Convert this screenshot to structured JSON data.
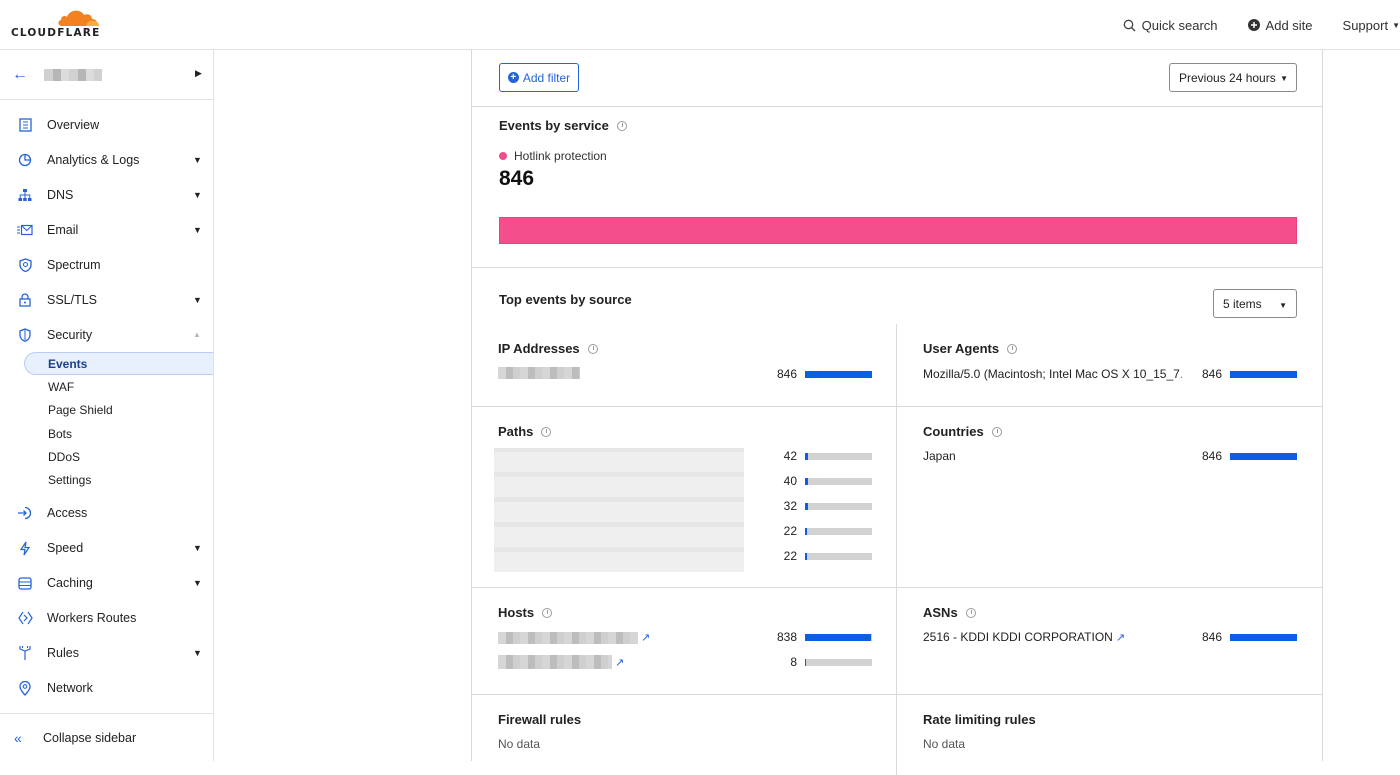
{
  "topbar": {
    "logo_text": "CLOUDFLARE",
    "quick_search": "Quick search",
    "add_site": "Add site",
    "support": "Support"
  },
  "sidebar": {
    "items": [
      {
        "label": "Overview",
        "icon": "document-icon",
        "caret": false
      },
      {
        "label": "Analytics & Logs",
        "icon": "chart-icon",
        "caret": true
      },
      {
        "label": "DNS",
        "icon": "network-tree-icon",
        "caret": true
      },
      {
        "label": "Email",
        "icon": "email-icon",
        "caret": true
      },
      {
        "label": "Spectrum",
        "icon": "shield-spectrum-icon",
        "caret": false
      },
      {
        "label": "SSL/TLS",
        "icon": "lock-icon",
        "caret": true
      },
      {
        "label": "Security",
        "icon": "shield-icon",
        "caret": "up"
      }
    ],
    "security_sub": [
      "Events",
      "WAF",
      "Page Shield",
      "Bots",
      "DDoS",
      "Settings"
    ],
    "items_after": [
      {
        "label": "Access",
        "icon": "access-icon",
        "caret": false
      },
      {
        "label": "Speed",
        "icon": "lightning-icon",
        "caret": true
      },
      {
        "label": "Caching",
        "icon": "caching-icon",
        "caret": true
      },
      {
        "label": "Workers Routes",
        "icon": "workers-icon",
        "caret": false
      },
      {
        "label": "Rules",
        "icon": "rules-icon",
        "caret": true
      },
      {
        "label": "Network",
        "icon": "location-pin-icon",
        "caret": false
      }
    ],
    "collapse_label": "Collapse sidebar"
  },
  "filters": {
    "add_filter": "Add filter",
    "time_range": "Previous 24 hours"
  },
  "events_by_service": {
    "title": "Events by service",
    "legend": "Hotlink protection",
    "total": "846",
    "color": "#f54e8c"
  },
  "top_events": {
    "title": "Top events by source",
    "items_select": "5 items",
    "ip_addresses": {
      "title": "IP Addresses",
      "rows": [
        {
          "value": 846,
          "max": 846
        }
      ]
    },
    "user_agents": {
      "title": "User Agents",
      "rows": [
        {
          "label": "Mozilla/5.0 (Macintosh; Intel Mac OS X 10_15_7…",
          "value": 846,
          "max": 846
        }
      ]
    },
    "paths": {
      "title": "Paths",
      "rows": [
        {
          "value": 42,
          "max": 846
        },
        {
          "value": 40,
          "max": 846
        },
        {
          "value": 32,
          "max": 846
        },
        {
          "value": 22,
          "max": 846
        },
        {
          "value": 22,
          "max": 846
        }
      ]
    },
    "countries": {
      "title": "Countries",
      "rows": [
        {
          "label": "Japan",
          "value": 846,
          "max": 846
        }
      ]
    },
    "hosts": {
      "title": "Hosts",
      "rows": [
        {
          "value": 838,
          "max": 846
        },
        {
          "value": 8,
          "max": 846
        }
      ]
    },
    "asns": {
      "title": "ASNs",
      "rows": [
        {
          "label": "2516 - KDDI KDDI CORPORATION",
          "value": 846,
          "max": 846
        }
      ]
    },
    "firewall_rules": {
      "title": "Firewall rules",
      "empty": "No data"
    },
    "rate_limiting_rules": {
      "title": "Rate limiting rules",
      "empty": "No data"
    }
  },
  "bar_color": "#0a5fe6"
}
